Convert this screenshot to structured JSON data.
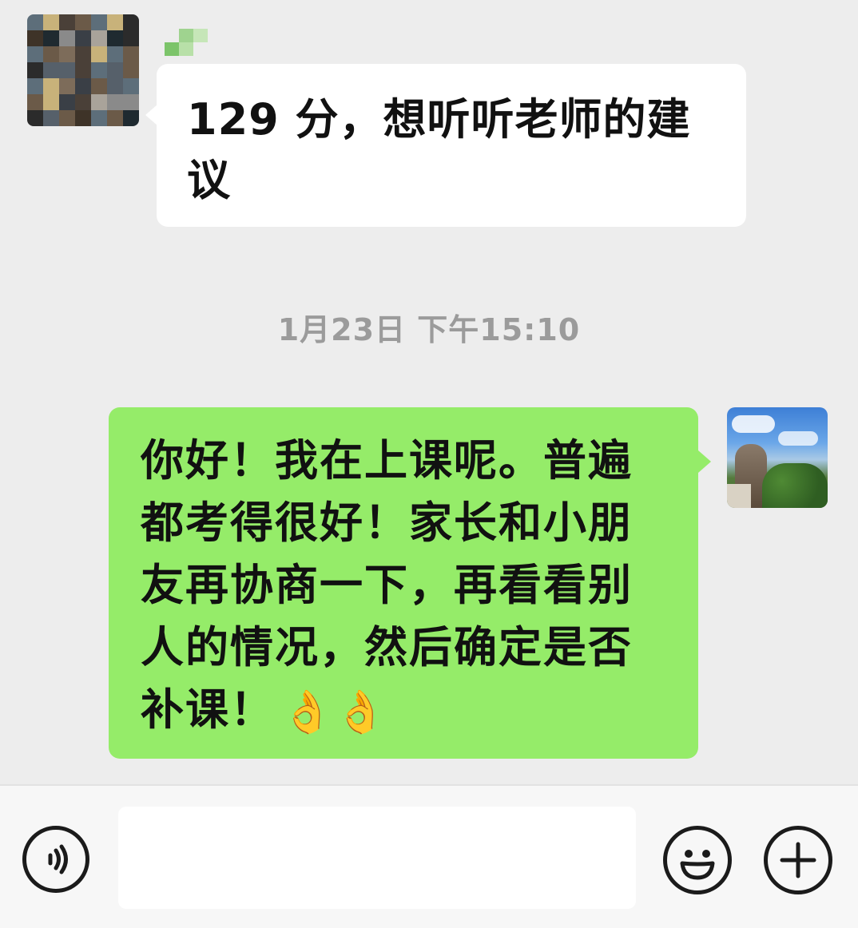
{
  "messages": [
    {
      "direction": "incoming",
      "text": "129 分，想听听老师的建议",
      "avatar": "pixelated-avatar",
      "bubble_color": "#ffffff"
    },
    {
      "direction": "outgoing",
      "text": "你好！我在上课呢。普遍都考得很好！家长和小朋友再协商一下，再看看别人的情况，然后确定是否补课！",
      "emoji": "👌👌",
      "avatar": "landscape-photo-avatar",
      "bubble_color": "#95ec69"
    }
  ],
  "timestamp": "1月23日 下午15:10",
  "input_bar": {
    "input_value": "",
    "icons": [
      "voice-icon",
      "emoji-icon",
      "plus-icon"
    ]
  },
  "colors": {
    "background": "#ededed",
    "outgoing_bubble": "#95ec69",
    "incoming_bubble": "#ffffff",
    "timestamp_text": "#9b9b9b"
  }
}
